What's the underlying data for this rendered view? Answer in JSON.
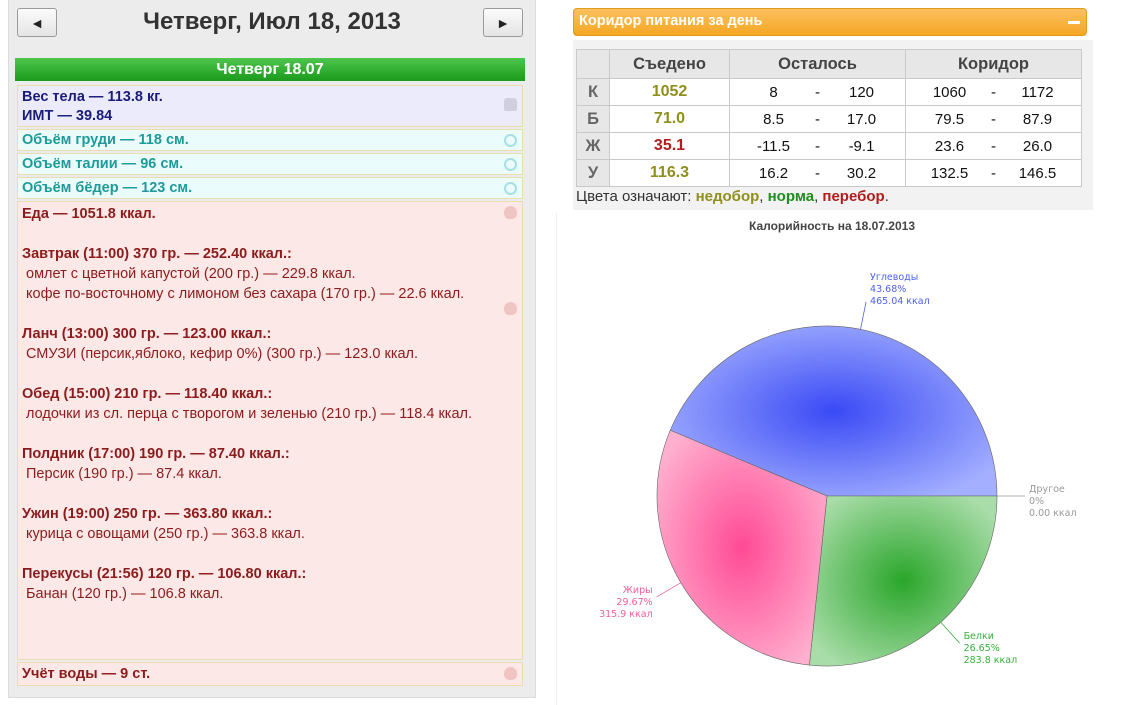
{
  "nav": {
    "prev_label": "◄",
    "next_label": "►",
    "date": "Четверг, Июл 18, 2013"
  },
  "day_bar": "Четверг 18.07",
  "body": {
    "weight": "Вес тела — 113.8 кг.",
    "bmi": "ИМТ — 39.84",
    "chest": "Объём груди — 118 см.",
    "waist": "Объём талии — 96 см.",
    "hips": "Объём бёдер — 123 см."
  },
  "food": {
    "total": "Еда — 1051.8 ккал.",
    "meals": [
      {
        "title": "Завтрак (11:00) 370 гр. — 252.40 ккал.:",
        "items": [
          " омлет с цветной капустой (200 гр.) — 229.8 ккал.",
          " кофе по-восточному с лимоном без сахара (170 гр.) — 22.6 ккал."
        ]
      },
      {
        "title": "Ланч (13:00) 300 гр. — 123.00 ккал.:",
        "items": [
          " СМУЗИ (персик,яблоко, кефир 0%) (300 гр.) — 123.0 ккал."
        ]
      },
      {
        "title": "Обед (15:00) 210 гр. — 118.40 ккал.:",
        "items": [
          " лодочки из сл. перца с творогом и зеленью (210 гр.) — 118.4 ккал."
        ]
      },
      {
        "title": "Полдник (17:00) 190 гр. — 87.40 ккал.:",
        "items": [
          " Персик (190 гр.) — 87.4 ккал."
        ]
      },
      {
        "title": "Ужин (19:00) 250 гр. — 363.80 ккал.:",
        "items": [
          " курица с овощами (250 гр.) — 363.8 ккал."
        ]
      },
      {
        "title": "Перекусы (21:56) 120 гр. — 106.80 ккал.:",
        "items": [
          " Банан (120 гр.) — 106.8 ккал."
        ]
      }
    ],
    "water": "Учёт воды — 9 ст."
  },
  "corridor": {
    "header": "Коридор питания за день",
    "columns": [
      "Съедено",
      "Осталось",
      "Коридор"
    ],
    "rows": [
      {
        "label": "К",
        "eaten": "1052",
        "eaten_color": "#8f8f1d",
        "left_lo": "8",
        "left_hi": "120",
        "cor_lo": "1060",
        "cor_hi": "1172"
      },
      {
        "label": "Б",
        "eaten": "71.0",
        "eaten_color": "#8f8f1d",
        "left_lo": "8.5",
        "left_hi": "17.0",
        "cor_lo": "79.5",
        "cor_hi": "87.9"
      },
      {
        "label": "Ж",
        "eaten": "35.1",
        "eaten_color": "#b01d1d",
        "left_lo": "-11.5",
        "left_hi": "-9.1",
        "cor_lo": "23.6",
        "cor_hi": "26.0"
      },
      {
        "label": "У",
        "eaten": "116.3",
        "eaten_color": "#8f8f1d",
        "left_lo": "16.2",
        "left_hi": "30.2",
        "cor_lo": "132.5",
        "cor_hi": "146.5"
      }
    ],
    "dash": "-",
    "legend": {
      "prefix": "Цвета означают: ",
      "under": "недобор",
      "sep1": ", ",
      "norm": "норма",
      "sep2": ", ",
      "over": "перебор",
      "end": "."
    }
  },
  "chart_data": {
    "type": "pie",
    "title": "Калорийность на 18.07.2013",
    "slices": [
      {
        "name": "Углеводы",
        "percent": 43.68,
        "percent_label": "43.68%",
        "value_label": "465.04 ккал",
        "color": "#5060f0"
      },
      {
        "name": "Белки",
        "percent": 26.65,
        "percent_label": "26.65%",
        "value_label": "283.8 ккал",
        "color": "#3ab03a"
      },
      {
        "name": "Жиры",
        "percent": 29.67,
        "percent_label": "29.67%",
        "value_label": "315.9 ккал",
        "color": "#f0609a"
      },
      {
        "name": "Другое",
        "percent": 0,
        "percent_label": "0%",
        "value_label": "0.00 ккал",
        "color": "#999999"
      }
    ]
  }
}
